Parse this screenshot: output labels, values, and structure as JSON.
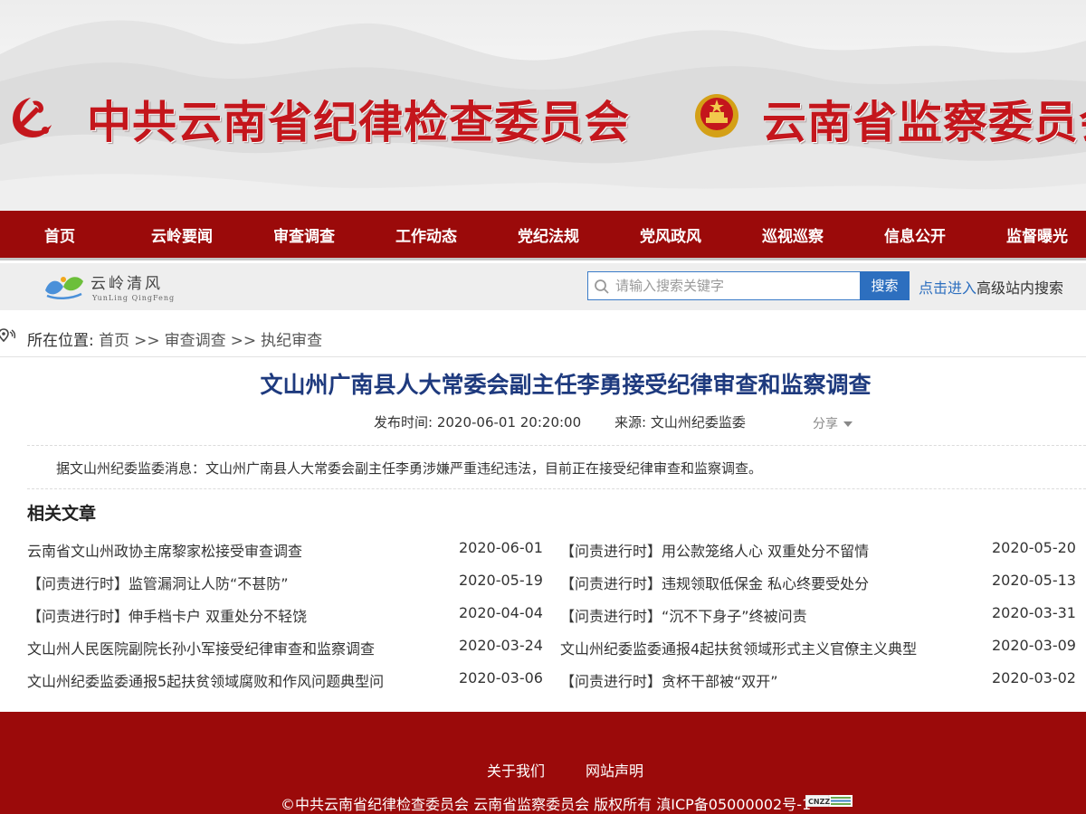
{
  "banner": {
    "title_main": "中共云南省纪律检查委员会",
    "title_sub": "云南省监察委员会",
    "brand_color": "#c4161c"
  },
  "nav": {
    "color": "#9b0a0a",
    "items": [
      "首页",
      "云岭要闻",
      "审查调查",
      "工作动态",
      "党纪法规",
      "党风政风",
      "巡视巡察",
      "信息公开",
      "监督曝光"
    ]
  },
  "subheader": {
    "logo_text": "云岭清风",
    "logo_subtext": "YunLing QingFeng",
    "search_placeholder": "请输入搜索关键字",
    "search_button": "搜索",
    "advanced_link": "点击进入",
    "advanced_text": "高级站内搜索"
  },
  "breadcrumb": {
    "label": "所在位置:",
    "items": [
      "首页",
      "审查调查",
      "执纪审查"
    ],
    "separator": ">>"
  },
  "article": {
    "title": "文山州广南县人大常委会副主任李勇接受纪律审查和监察调查",
    "publish_label": "发布时间: 2020-06-01 20:20:00",
    "source_label": "来源: 文山州纪委监委",
    "share_label": "分享",
    "body": "据文山州纪委监委消息：文山州广南县人大常委会副主任李勇涉嫌严重违纪违法，目前正在接受纪律审查和监察调查。"
  },
  "related": {
    "heading": "相关文章",
    "left": [
      {
        "title": "云南省文山州政协主席黎家松接受审查调查",
        "date": "2020-06-01"
      },
      {
        "title": "【问责进行时】监管漏洞让人防“不甚防”",
        "date": "2020-05-19"
      },
      {
        "title": "【问责进行时】伸手档卡户 双重处分不轻饶",
        "date": "2020-04-04"
      },
      {
        "title": "文山州人民医院副院长孙小军接受纪律审查和监察调查",
        "date": "2020-03-24"
      },
      {
        "title": "文山州纪委监委通报5起扶贫领域腐败和作风问题典型问",
        "date": "2020-03-06"
      }
    ],
    "right": [
      {
        "title": "【问责进行时】用公款笼络人心 双重处分不留情",
        "date": "2020-05-20"
      },
      {
        "title": "【问责进行时】违规领取低保金 私心终要受处分",
        "date": "2020-05-13"
      },
      {
        "title": "【问责进行时】“沉不下身子”终被问责",
        "date": "2020-03-31"
      },
      {
        "title": "文山州纪委监委通报4起扶贫领域形式主义官僚主义典型",
        "date": "2020-03-09"
      },
      {
        "title": "【问责进行时】贪杯干部被“双开”",
        "date": "2020-03-02"
      }
    ]
  },
  "footer": {
    "links": [
      "关于我们",
      "网站声明"
    ],
    "copyright": "©中共云南省纪律检查委员会 云南省监察委员会 版权所有 滇ICP备05000002号-1",
    "badge_text": "CNZZ"
  }
}
